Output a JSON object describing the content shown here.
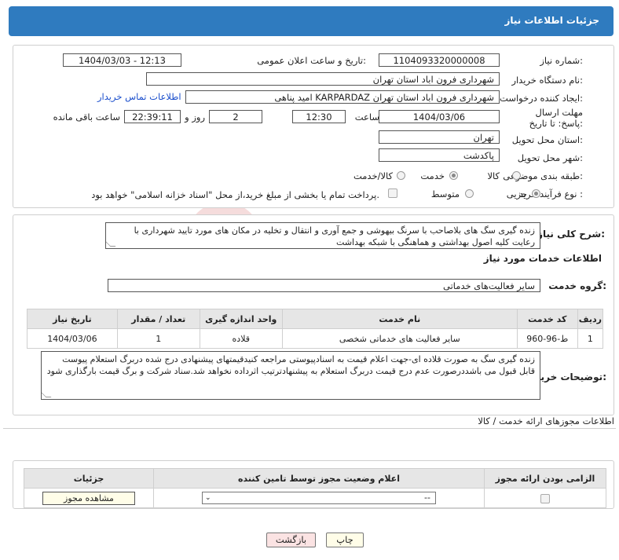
{
  "header": {
    "title": "جزئیات اطلاعات نیاز"
  },
  "form": {
    "need_number": {
      "label": "شماره نیاز:",
      "value": "1104093320000008"
    },
    "announce": {
      "label": "تاریخ و ساعت اعلان عمومی:",
      "value": "1404/03/03 - 12:13"
    },
    "buyer_org": {
      "label": "نام دستگاه خریدار:",
      "value": "شهرداری فرون اباد استان تهران"
    },
    "requester": {
      "label": "ایجاد کننده درخواست:",
      "value": "امید پناهی KARPARDAZ شهرداری فرون اباد استان تهران",
      "contact_link": "اطلاعات تماس خریدار"
    },
    "deadline": {
      "label": "مهلت ارسال پاسخ: تا تاریخ:",
      "date": "1404/03/06",
      "time_label": "ساعت",
      "time": "12:30",
      "days": "2",
      "days_label": "روز و",
      "remaining": "22:39:11",
      "remaining_label": "ساعت باقی مانده"
    },
    "province": {
      "label": "استان محل تحویل:",
      "value": "تهران"
    },
    "city": {
      "label": "شهر محل تحویل:",
      "value": "پاکدشت"
    },
    "category": {
      "label": "طبقه بندی موضوعی:",
      "options": [
        "کالا",
        "خدمت",
        "کالا/خدمت"
      ],
      "selected": "خدمت"
    },
    "process": {
      "label": "نوع فرآیند خرید :",
      "options": [
        "جزیی",
        "متوسط"
      ],
      "selected": "جزیی",
      "note": "پرداخت تمام یا بخشی از مبلغ خرید،از محل \"اسناد خزانه اسلامی\" خواهد بود."
    }
  },
  "description": {
    "label": "شرح کلی نیاز:",
    "text": "زنده گیری سگ های بلاصاحب با سرنگ بیهوشی و جمع آوری و انتقال و تخلیه در مکان های مورد تایید شهرداری با رعایت کلیه اصول بهداشتی و هماهنگی با شبکه بهداشت"
  },
  "services": {
    "title": "اطلاعات خدمات مورد نیاز",
    "group_label": "گروه خدمت:",
    "group_value": "سایر فعالیت‌های خدماتی",
    "columns": [
      "ردیف",
      "کد خدمت",
      "نام خدمت",
      "واحد اندازه گیری",
      "تعداد / مقدار",
      "تاریخ نیاز"
    ],
    "rows": [
      [
        "1",
        "ط-96-960",
        "سایر فعالیت های خدماتی شخصی",
        "قلاده",
        "1",
        "1404/03/06"
      ]
    ]
  },
  "buyer_notes": {
    "label": "توضیحات خریدار:",
    "text": "زنده گیری سگ به صورت قلاده ای-جهت اعلام قیمت به اسنادپیوستی مراجعه کنیدقیمتهای پیشنهادی درج شده دربرگ استعلام پیوست قابل قبول می باشددرصورت عدم درج قیمت دربرگ استعلام به پیشنهادترتیب اثرداده نخواهد شد.سناد شرکت و برگ قیمت بارگذاری شود"
  },
  "permits": {
    "title": "اطلاعات مجوزهای ارائه خدمت / کالا",
    "columns": [
      "الزامی بودن ارائه مجوز",
      "اعلام وضعیت مجوز توسط تامین کننده",
      "جزئیات"
    ],
    "select_value": "--",
    "view_button": "مشاهده مجوز"
  },
  "actions": {
    "print": "چاپ",
    "back": "بازگشت"
  },
  "colors": {
    "header": "#2f7bbf",
    "link": "#1a4ecc",
    "back_button_bg": "#fbe3e3",
    "print_button_bg": "#fffde8"
  }
}
